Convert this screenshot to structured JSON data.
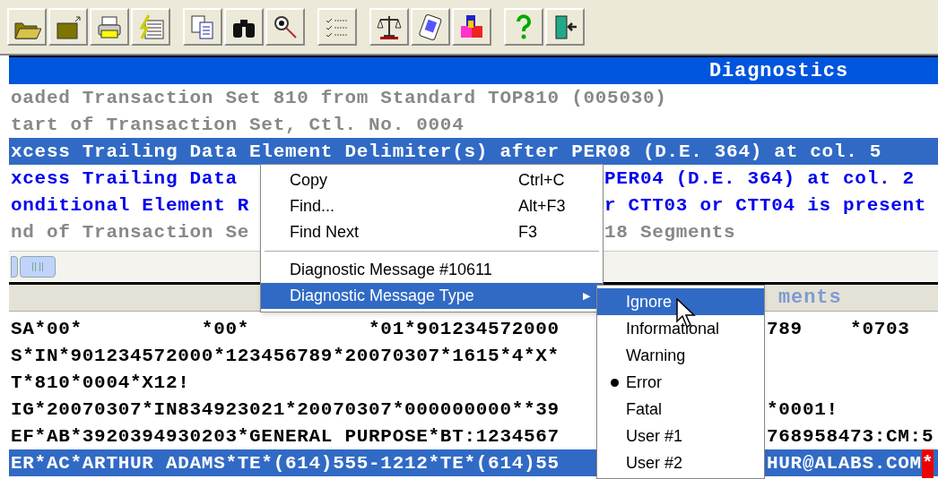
{
  "diagnostics": {
    "title": "Diagnostics",
    "lines": [
      {
        "kind": "info",
        "selected": false,
        "parts": [
          "oaded Transaction Set 810 from Standard TOP810 (005030)"
        ]
      },
      {
        "kind": "info",
        "selected": false,
        "parts": [
          "tart of Transaction Set, Ctl. No. 0004"
        ]
      },
      {
        "kind": "error",
        "selected": true,
        "parts": [
          "xcess Trailing Data Element Delimiter(s) after PER08 (D.E. 364) at col. 5"
        ]
      },
      {
        "kind": "error",
        "selected": false,
        "parts": [
          "xcess Trailing Data ",
          "PER04 (D.E. 364) at col. 2"
        ]
      },
      {
        "kind": "error",
        "selected": false,
        "parts": [
          "onditional Element R",
          "r CTT03 or CTT04 is present"
        ]
      },
      {
        "kind": "info",
        "selected": false,
        "parts": [
          "nd of Transaction Se",
          "18 Segments"
        ]
      }
    ]
  },
  "segments": {
    "title": "ments",
    "rows": [
      {
        "selected": false,
        "parts": [
          "SA*00*          *00*          *01*901234572000",
          "789    *0703"
        ]
      },
      {
        "selected": false,
        "parts": [
          "S*IN*901234572000*123456789*20070307*1615*4*X*"
        ]
      },
      {
        "selected": false,
        "parts": [
          "T*810*0004*X12!"
        ]
      },
      {
        "selected": false,
        "parts": [
          "IG*20070307*IN834923021*20070307*000000000**39",
          "*0001!"
        ]
      },
      {
        "selected": false,
        "parts": [
          "EF*AB*3920394930203*GENERAL PURPOSE*BT:1234567",
          "768958473:CM:5"
        ]
      },
      {
        "selected": true,
        "parts": [
          "ER*AC*ARTHUR ADAMS*TE*(614)555-1212*TE*(614)55",
          "HUR@ALABS.COM"
        ],
        "flag": "*"
      }
    ]
  },
  "context_menu": {
    "items": [
      {
        "kind": "item",
        "label": "Copy",
        "shortcut": "Ctrl+C",
        "selected": false
      },
      {
        "kind": "item",
        "label": "Find...",
        "shortcut": "Alt+F3",
        "selected": false
      },
      {
        "kind": "item",
        "label": "Find Next",
        "shortcut": "F3",
        "selected": false
      },
      {
        "kind": "separator"
      },
      {
        "kind": "item",
        "label": "Diagnostic Message #10611",
        "selected": false
      },
      {
        "kind": "submenu",
        "label": "Diagnostic Message Type",
        "arrow": "▶",
        "selected": true
      }
    ]
  },
  "submenu": {
    "items": [
      {
        "label": "Ignore",
        "selected": true,
        "checked": false
      },
      {
        "label": "Informational",
        "selected": false,
        "checked": false
      },
      {
        "label": "Warning",
        "selected": false,
        "checked": false
      },
      {
        "label": "Error",
        "selected": false,
        "checked": true
      },
      {
        "label": "Fatal",
        "selected": false,
        "checked": false
      },
      {
        "label": "User #1",
        "selected": false,
        "checked": false
      },
      {
        "label": "User #2",
        "selected": false,
        "checked": false
      }
    ]
  }
}
